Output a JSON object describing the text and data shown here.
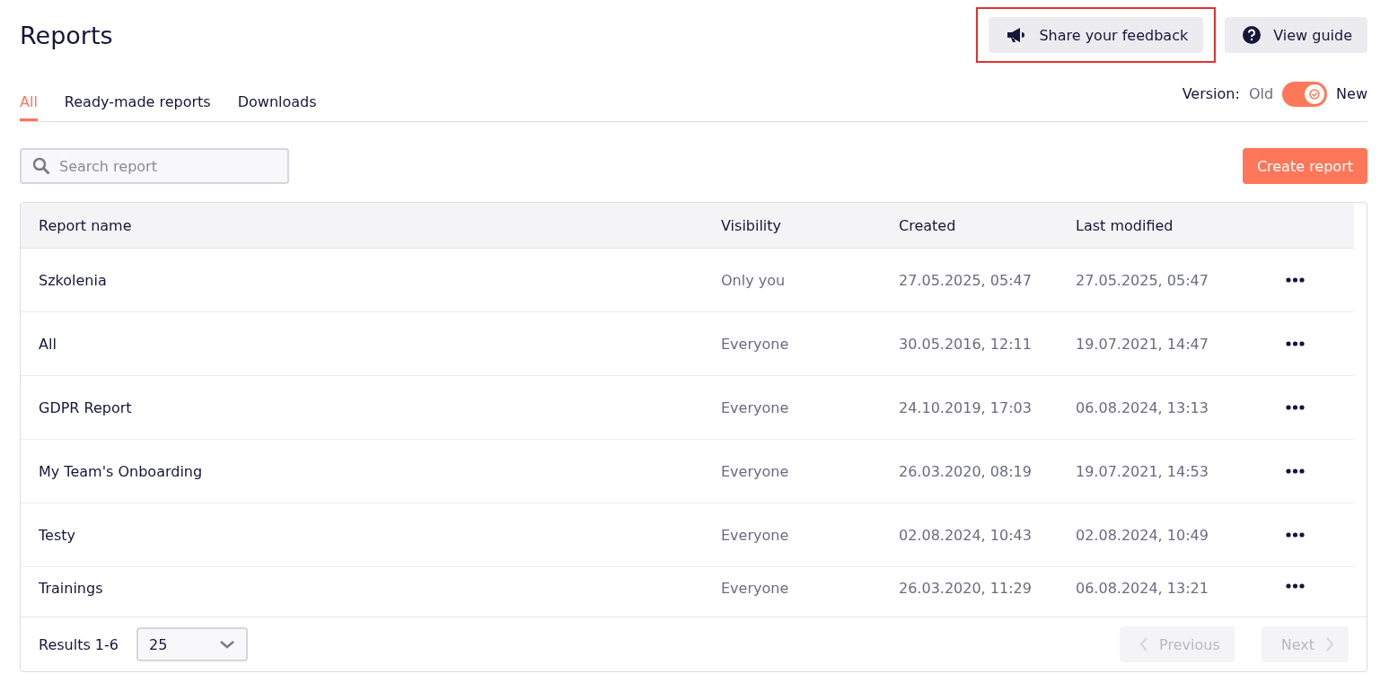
{
  "page": {
    "title": "Reports"
  },
  "header_buttons": [
    {
      "label": "Share your feedback",
      "kind": "feedback",
      "highlighted": true
    },
    {
      "label": "View guide",
      "kind": "guide",
      "highlighted": false
    }
  ],
  "tabs": [
    {
      "label": "All",
      "selected": true
    },
    {
      "label": "Ready-made reports",
      "selected": false
    },
    {
      "label": "Downloads",
      "selected": false
    }
  ],
  "version_toggle": {
    "label": "Version:",
    "off_label": "Old",
    "on_label": "New",
    "on": true
  },
  "search": {
    "placeholder": "Search report"
  },
  "create_button": {
    "label": "Create report"
  },
  "table": {
    "columns": [
      "Report name",
      "Visibility",
      "Created",
      "Last modified"
    ],
    "rows": [
      {
        "name": "Szkolenia",
        "visibility": "Only you",
        "created": "27.05.2025, 05:47",
        "modified": "27.05.2025, 05:47"
      },
      {
        "name": "All",
        "visibility": "Everyone",
        "created": "30.05.2016, 12:11",
        "modified": "19.07.2021, 14:47"
      },
      {
        "name": "GDPR Report",
        "visibility": "Everyone",
        "created": "24.10.2019, 17:03",
        "modified": "06.08.2024, 13:13"
      },
      {
        "name": "My Team's Onboarding",
        "visibility": "Everyone",
        "created": "26.03.2020, 08:19",
        "modified": "19.07.2021, 14:53"
      },
      {
        "name": "Testy",
        "visibility": "Everyone",
        "created": "02.08.2024, 10:43",
        "modified": "02.08.2024, 10:49"
      },
      {
        "name": "Trainings",
        "visibility": "Everyone",
        "created": "26.03.2020, 11:29",
        "modified": "06.08.2024, 13:21"
      }
    ]
  },
  "footer": {
    "results": "Results 1-6",
    "page_size": "25",
    "pagination": [
      {
        "label": "Previous",
        "kind": "previous",
        "disabled": true
      },
      {
        "label": "Next",
        "kind": "next",
        "disabled": true
      }
    ]
  }
}
